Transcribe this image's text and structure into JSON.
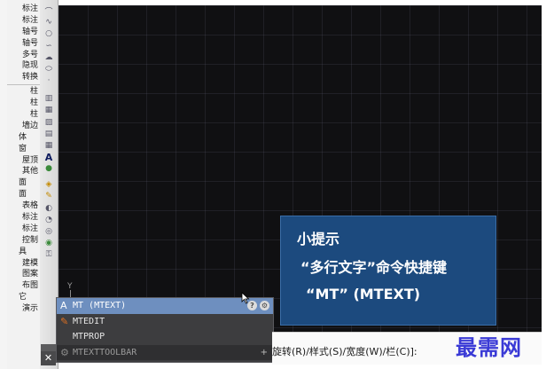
{
  "palette": {
    "items": [
      "标注",
      "标注",
      "轴号",
      "轴号",
      "多号",
      "隐现",
      "转换",
      "柱",
      "柱",
      "柱",
      "墙边",
      "体",
      "窗",
      "屋顶",
      "其他",
      "面",
      "面",
      "表格",
      "标注",
      "标注",
      "控制",
      "具",
      "建模",
      "图案",
      "布图",
      "它",
      "演示"
    ]
  },
  "toolbar": {
    "icons": [
      "arc-icon",
      "polyline-icon",
      "circle-icon",
      "spline-icon",
      "revcloud-icon",
      "ellipse-icon",
      "point-icon",
      "insert-block-icon",
      "make-block-icon",
      "hatch-icon",
      "gradient-icon",
      "region-icon",
      "table-icon",
      "mtext-icon",
      "add-selected-icon",
      "layer-icon",
      "match-icon",
      "properties-icon",
      "dist-icon",
      "area-icon",
      "cal-icon",
      "lock-icon"
    ]
  },
  "canvas": {
    "ucs_label": "Y"
  },
  "tip": {
    "title": "小提示",
    "line1": "“多行文字”命令快捷键",
    "line2": "“MT” (MTEXT)"
  },
  "autocomplete": {
    "items": [
      {
        "label": "MT (MTEXT)",
        "icon": "mtext-icon",
        "selected": true
      },
      {
        "label": "MTEDIT",
        "icon": "pen-icon",
        "selected": false
      },
      {
        "label": "MTPROP",
        "icon": "",
        "selected": false
      },
      {
        "label": "MTEXTTOOLBAR",
        "icon": "gear-icon",
        "selected": false
      }
    ],
    "help_glyph": "?",
    "settings_glyph": "⚙",
    "expand_glyph": "+"
  },
  "command_line": {
    "close_glyph": "✕",
    "prompt": "旋转(R)/样式(S)/宽度(W)/栏(C)]:"
  },
  "watermark": {
    "text": "最需网"
  },
  "colors": {
    "canvas_bg": "#101012",
    "tip_bg": "#1c4a7e",
    "autocomplete_bg": "#3d3d3f",
    "autocomplete_selected": "#6e8fbf",
    "watermark": "#3a3ad6"
  }
}
